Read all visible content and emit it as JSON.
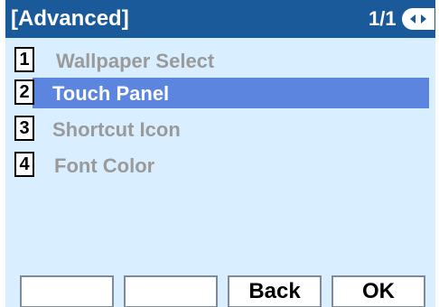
{
  "header": {
    "title": "[Advanced]",
    "page": "1/1"
  },
  "menu": {
    "items": [
      {
        "num": "1",
        "label": "Wallpaper Select"
      },
      {
        "num": "2",
        "label": "Touch Panel"
      },
      {
        "num": "3",
        "label": "Shortcut Icon"
      },
      {
        "num": "4",
        "label": "Font Color"
      }
    ],
    "selected_index": 1
  },
  "softkeys": [
    "",
    "",
    "Back",
    "OK"
  ],
  "colors": {
    "header_bg": "#1b5a9a",
    "screen_bg": "#d9efff",
    "highlight": "#5b85df",
    "disabled_text": "#9a9a9a"
  }
}
